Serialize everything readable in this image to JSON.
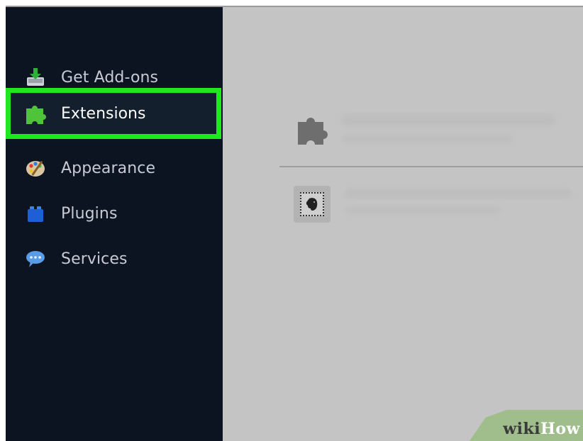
{
  "sidebar": {
    "items": [
      {
        "label": "Get Add-ons",
        "icon": "download-box-icon"
      },
      {
        "label": "Extensions",
        "icon": "puzzle-piece-icon",
        "selected": true
      },
      {
        "label": "Appearance",
        "icon": "paint-palette-icon"
      },
      {
        "label": "Plugins",
        "icon": "lego-brick-icon"
      },
      {
        "label": "Services",
        "icon": "speech-bubble-icon"
      }
    ],
    "highlight_color": "#1ee81e"
  },
  "main": {
    "header_icon": "puzzle-piece-icon",
    "extension_icon": "evernote-elephant-icon"
  },
  "watermark": {
    "wiki": "wiki",
    "how": "How"
  }
}
